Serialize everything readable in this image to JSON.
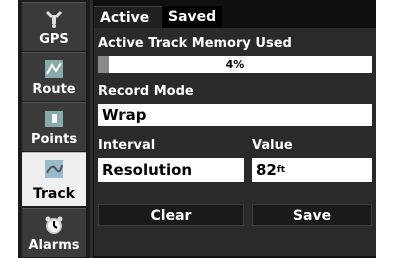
{
  "sidebar": {
    "items": [
      {
        "label": "GPS",
        "icon": "gps-icon"
      },
      {
        "label": "Route",
        "icon": "route-icon"
      },
      {
        "label": "Points",
        "icon": "points-icon"
      },
      {
        "label": "Track",
        "icon": "track-icon",
        "selected": true
      },
      {
        "label": "Alarms",
        "icon": "alarms-icon"
      }
    ]
  },
  "tabs": [
    {
      "label": "Active",
      "active": false
    },
    {
      "label": "Saved",
      "active": true
    }
  ],
  "memory": {
    "title": "Active Track Memory Used",
    "percent_text": "4%",
    "fraction": 0.04
  },
  "record_mode": {
    "label": "Record Mode",
    "value": "Wrap"
  },
  "interval": {
    "label": "Interval",
    "value": "Resolution"
  },
  "value": {
    "label": "Value",
    "number": "82",
    "unit": "ft"
  },
  "buttons": {
    "clear": "Clear",
    "save": "Save"
  },
  "colors": {
    "background": "#101010",
    "field": "#ffffff",
    "selected_sidebar": "#efefef"
  }
}
